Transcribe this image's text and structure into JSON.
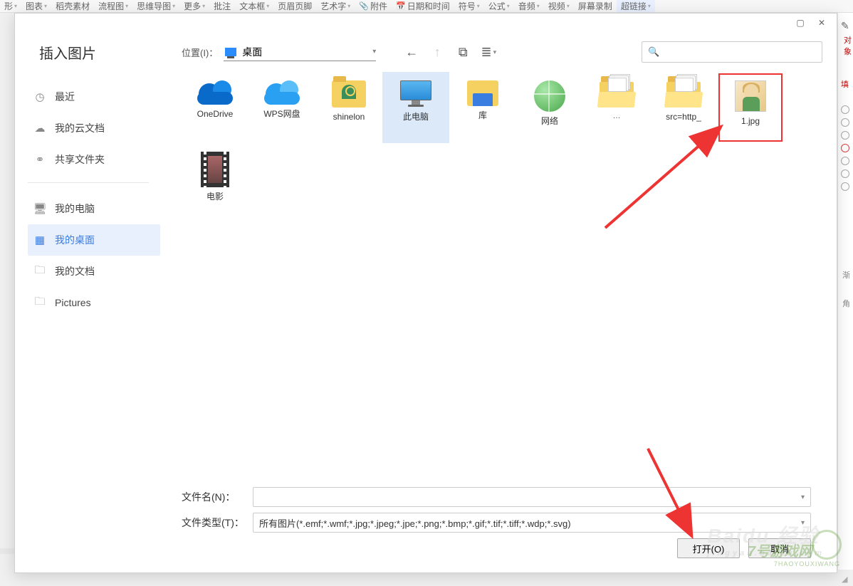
{
  "ribbon": {
    "items": [
      {
        "label": "形",
        "drop": true
      },
      {
        "label": "图表",
        "drop": true
      },
      {
        "label": "稻壳素材",
        "drop": false
      },
      {
        "label": "流程图",
        "drop": true
      },
      {
        "label": "思维导图",
        "drop": true
      },
      {
        "label": "更多",
        "drop": true
      },
      {
        "label": "批注",
        "drop": false
      },
      {
        "label": "文本框",
        "drop": true
      },
      {
        "label": "页眉页脚",
        "drop": false
      },
      {
        "label": "艺术字",
        "drop": true
      },
      {
        "label": "附件",
        "drop": false,
        "icon": "att"
      },
      {
        "label": "日期和时间",
        "drop": false,
        "icon": "cal"
      },
      {
        "label": "符号",
        "drop": true
      },
      {
        "label": "公式",
        "drop": true
      },
      {
        "label": "音频",
        "drop": true
      },
      {
        "label": "视频",
        "drop": true
      },
      {
        "label": "屏幕录制",
        "drop": false
      },
      {
        "label": "超链接",
        "drop": true,
        "last": true
      }
    ]
  },
  "right_panel": {
    "hint": "对象",
    "word": "填",
    "lab1": "渐",
    "lab2": "角"
  },
  "dialog": {
    "title": "插入图片",
    "sidebar": {
      "items": [
        {
          "icon": "◷",
          "label": "最近"
        },
        {
          "icon": "☁",
          "label": "我的云文档"
        },
        {
          "icon": "⚭",
          "label": "共享文件夹"
        },
        {
          "icon": "🖥",
          "label": "我的电脑"
        },
        {
          "icon": "▦",
          "label": "我的桌面",
          "active": true
        },
        {
          "icon": "🗀",
          "label": "我的文档"
        },
        {
          "icon": "🗀",
          "label": "Pictures"
        }
      ]
    },
    "toolbar": {
      "loc_label": "位置(I)：",
      "loc_value": "桌面",
      "back_tip": "←",
      "up_tip": "↑",
      "new_tip": "⧉",
      "view_tip": "≣"
    },
    "files": [
      {
        "kind": "cloud",
        "label": "OneDrive"
      },
      {
        "kind": "cloud-light",
        "label": "WPS网盘"
      },
      {
        "kind": "folder-avatar",
        "label": "shinelon"
      },
      {
        "kind": "monitor",
        "label": "此电脑",
        "selected": true
      },
      {
        "kind": "library",
        "label": "库"
      },
      {
        "kind": "network",
        "label": "网络"
      },
      {
        "kind": "folder-docs",
        "label": "",
        "ext": "…"
      },
      {
        "kind": "folder-docs",
        "label": "src=http_"
      },
      {
        "kind": "thumb",
        "label": "1.jpg",
        "highlight": true
      },
      {
        "kind": "movie",
        "label": "电影"
      }
    ],
    "form": {
      "name_label": "文件名(N)：",
      "name_value": "",
      "type_label": "文件类型(T)：",
      "type_value": "所有图片(*.emf;*.wmf;*.jpg;*.jpeg;*.jpe;*.png;*.bmp;*.gif;*.tif;*.tiff;*.wdp;*.svg)",
      "open": "打开(O)",
      "cancel": "取消"
    }
  },
  "watermark": {
    "main": "Baidu 经验",
    "sub": "jingyan.baidu.com",
    "site": "7号游戏网",
    "site_sub": "7HAOYOUXIWANG"
  }
}
